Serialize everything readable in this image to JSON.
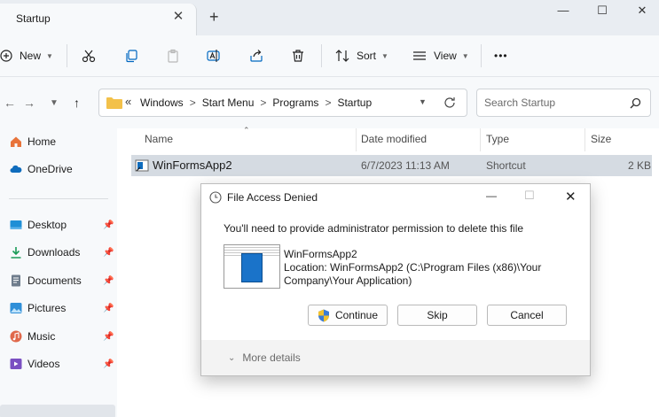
{
  "window": {
    "tab_title": "Startup",
    "tab_close_glyph": "✕",
    "new_tab_glyph": "+",
    "minimize_glyph": "—",
    "maximize_glyph": "☐",
    "close_glyph": "✕"
  },
  "toolbar": {
    "new_label": "New",
    "sort_label": "Sort",
    "view_label": "View",
    "more_glyph": "•••",
    "icons": [
      "new-icon",
      "cut-icon",
      "copy-icon",
      "paste-icon",
      "rename-icon",
      "share-icon",
      "delete-icon",
      "sort-icon",
      "view-icon",
      "more-icon"
    ]
  },
  "address": {
    "overflow_glyph": "«",
    "breadcrumbs": [
      "Windows",
      "Start Menu",
      "Programs",
      "Startup"
    ],
    "separator": ">",
    "search_placeholder": "Search Startup"
  },
  "sidebar": {
    "items": [
      {
        "label": "Home",
        "icon": "home-icon",
        "pinned": false
      },
      {
        "label": "OneDrive",
        "icon": "cloud-icon",
        "pinned": false
      },
      {
        "label": "Desktop",
        "icon": "desktop-icon",
        "pinned": true
      },
      {
        "label": "Downloads",
        "icon": "download-icon",
        "pinned": true
      },
      {
        "label": "Documents",
        "icon": "documents-icon",
        "pinned": true
      },
      {
        "label": "Pictures",
        "icon": "pictures-icon",
        "pinned": true
      },
      {
        "label": "Music",
        "icon": "music-icon",
        "pinned": true
      },
      {
        "label": "Videos",
        "icon": "videos-icon",
        "pinned": true
      }
    ]
  },
  "filelist": {
    "columns": [
      "Name",
      "Date modified",
      "Type",
      "Size"
    ],
    "rows": [
      {
        "name": "WinFormsApp2",
        "date": "6/7/2023 11:13 AM",
        "type": "Shortcut",
        "size": "2 KB"
      }
    ]
  },
  "dialog": {
    "title": "File Access Denied",
    "message": "You'll need to provide administrator permission to delete this file",
    "file_name": "WinFormsApp2",
    "location_line1": "Location: WinFormsApp2 (C:\\Program Files (x86)\\Your",
    "location_line2": "Company\\Your Application)",
    "continue_label": "Continue",
    "skip_label": "Skip",
    "cancel_label": "Cancel",
    "more_details_label": "More details"
  },
  "colors": {
    "accent": "#0067c0",
    "folder": "#f3c14a",
    "selection": "#d5dbe2"
  }
}
